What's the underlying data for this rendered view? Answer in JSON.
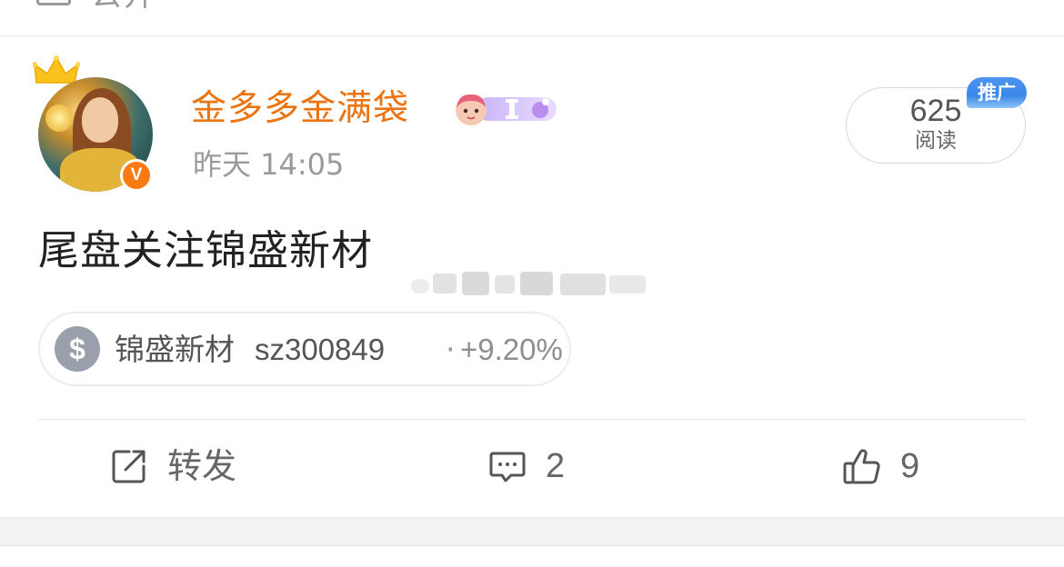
{
  "top_strip": {
    "label": "公开"
  },
  "post": {
    "author": {
      "name": "金多多金满袋",
      "verified_badge": "V",
      "crown_icon": "crown-icon",
      "level_badge_icon": "level-badge-icon"
    },
    "timestamp": "昨天 14:05",
    "views": {
      "count": "625",
      "label": "阅读",
      "promo_tag": "推广"
    },
    "text": "尾盘关注锦盛新材",
    "stock": {
      "icon": "$",
      "name": "锦盛新材",
      "code": "sz300849",
      "separator": "·",
      "change": "+9.20%"
    },
    "actions": {
      "repost": {
        "label": "转发",
        "icon": "repost-icon"
      },
      "comment": {
        "count": "2",
        "icon": "comment-icon"
      },
      "like": {
        "count": "9",
        "icon": "thumbs-up-icon"
      }
    }
  },
  "colors": {
    "username": "#eb7310",
    "verified": "#fb7a14",
    "promo_tag": "#3a86ea",
    "text_primary": "#222222",
    "text_secondary": "#9a9a9a"
  }
}
